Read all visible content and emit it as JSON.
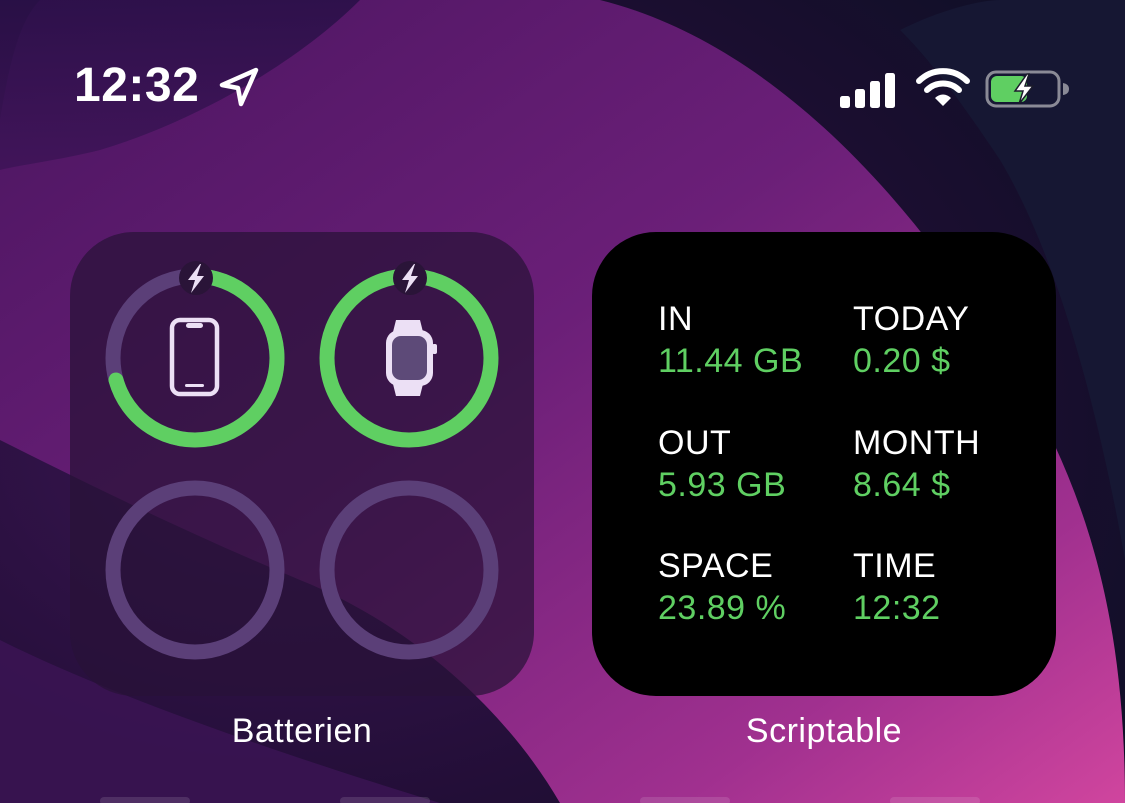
{
  "status_bar": {
    "time": "12:32",
    "icons": [
      "location-arrow-icon",
      "cellular-signal-icon",
      "wifi-icon",
      "battery-charging-icon"
    ]
  },
  "widgets": {
    "batteries": {
      "label": "Batterien",
      "devices": [
        {
          "icon": "iphone-icon",
          "charging": true,
          "level": 0.68
        },
        {
          "icon": "apple-watch-icon",
          "charging": true,
          "level": 1.0
        },
        {
          "icon": "empty-slot",
          "charging": false,
          "level": 0
        },
        {
          "icon": "empty-slot",
          "charging": false,
          "level": 0
        }
      ],
      "colors": {
        "ring": "#5fcf62",
        "track": "#5b3f78",
        "icon": "#ece0f5"
      }
    },
    "scriptable": {
      "label": "Scriptable",
      "stats": [
        {
          "title": "IN",
          "value": "11.44 GB"
        },
        {
          "title": "TODAY",
          "value": "0.20 $"
        },
        {
          "title": "OUT",
          "value": "5.93 GB"
        },
        {
          "title": "MONTH",
          "value": "8.64 $"
        },
        {
          "title": "SPACE",
          "value": "23.89 %"
        },
        {
          "title": "TIME",
          "value": "12:32"
        }
      ],
      "colors": {
        "title": "#ffffff",
        "value": "#5fcf62",
        "background": "#000000"
      }
    }
  }
}
